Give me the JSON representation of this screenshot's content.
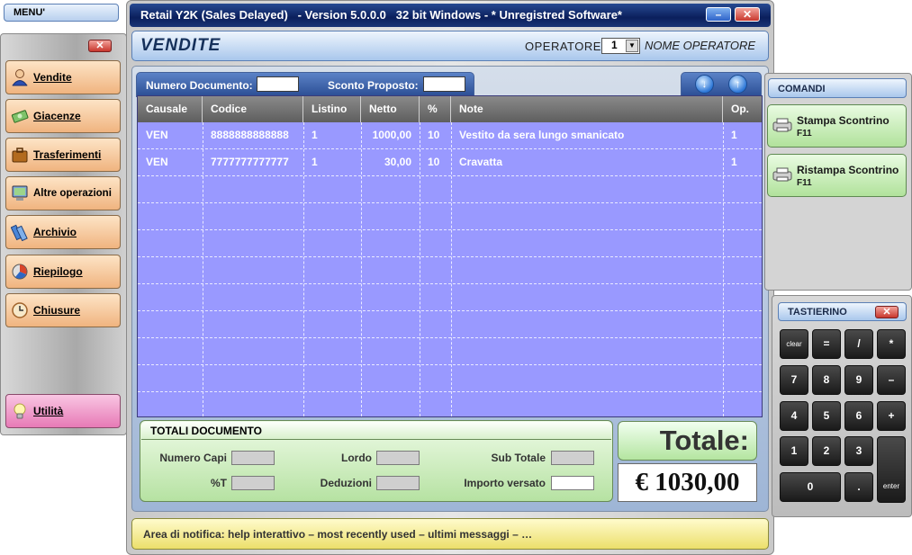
{
  "window": {
    "title": "Retail Y2K (Sales Delayed)   - Version 5.0.0.0   32 bit Windows - * Unregistred Software*",
    "minimize_glyph": "–",
    "close_glyph": "✕"
  },
  "menu": {
    "title": "MENU'",
    "close_glyph": "✕",
    "items": [
      {
        "label": "Vendite",
        "icon": "user-icon"
      },
      {
        "label": "Giacenze",
        "icon": "money-icon"
      },
      {
        "label": "Trasferimenti",
        "icon": "briefcase-icon"
      },
      {
        "label": "Altre operazioni",
        "icon": "monitor-icon"
      },
      {
        "label": "Archivio",
        "icon": "books-icon"
      },
      {
        "label": "Riepilogo",
        "icon": "chart-icon"
      },
      {
        "label": "Chiusure",
        "icon": "clock-icon"
      }
    ],
    "utility": {
      "label": "Utilità",
      "icon": "lightbulb-icon"
    }
  },
  "header": {
    "section_title": "VENDITE",
    "operatore_label": "OPERATORE",
    "operatore_value": "1",
    "operatore_name": "NOME OPERATORE"
  },
  "doc": {
    "numero_label": "Numero Documento:",
    "numero_value": "",
    "sconto_label": "Sconto Proposto:",
    "sconto_value": "",
    "nav_down": "↓",
    "nav_up": "↑"
  },
  "grid": {
    "columns": [
      "Causale",
      "Codice",
      "Listino",
      "Netto",
      "%",
      "Note",
      "Op."
    ],
    "rows": [
      {
        "causale": "VEN",
        "codice": "8888888888888",
        "listino": "1",
        "netto": "1000,00",
        "perc": "10",
        "note": "Vestito da sera lungo smanicato",
        "op": "1"
      },
      {
        "causale": "VEN",
        "codice": "7777777777777",
        "listino": "1",
        "netto": "30,00",
        "perc": "10",
        "note": "Cravatta",
        "op": "1"
      }
    ]
  },
  "totali": {
    "title": "TOTALI DOCUMENTO",
    "numero_capi": "Numero Capi",
    "perc_t": "%T",
    "lordo": "Lordo",
    "deduzioni": "Deduzioni",
    "sub_totale": "Sub Totale",
    "importo_versato": "Importo versato"
  },
  "totale": {
    "label": "Totale:",
    "value": "€ 1030,00"
  },
  "notifica": "Area di notifica: help interattivo – most recently used – ultimi messaggi – …",
  "comandi": {
    "title": "COMANDI",
    "buttons": [
      {
        "label": "Stampa Scontrino",
        "key": "F11"
      },
      {
        "label": "Ristampa Scontrino",
        "key": "F11"
      }
    ]
  },
  "tastierino": {
    "title": "TASTIERINO",
    "close_glyph": "✕",
    "keys": [
      "clear",
      "=",
      "/",
      "*",
      "7",
      "8",
      "9",
      "–",
      "4",
      "5",
      "6",
      "+",
      "1",
      "2",
      "3",
      "0",
      ".",
      "enter"
    ]
  }
}
